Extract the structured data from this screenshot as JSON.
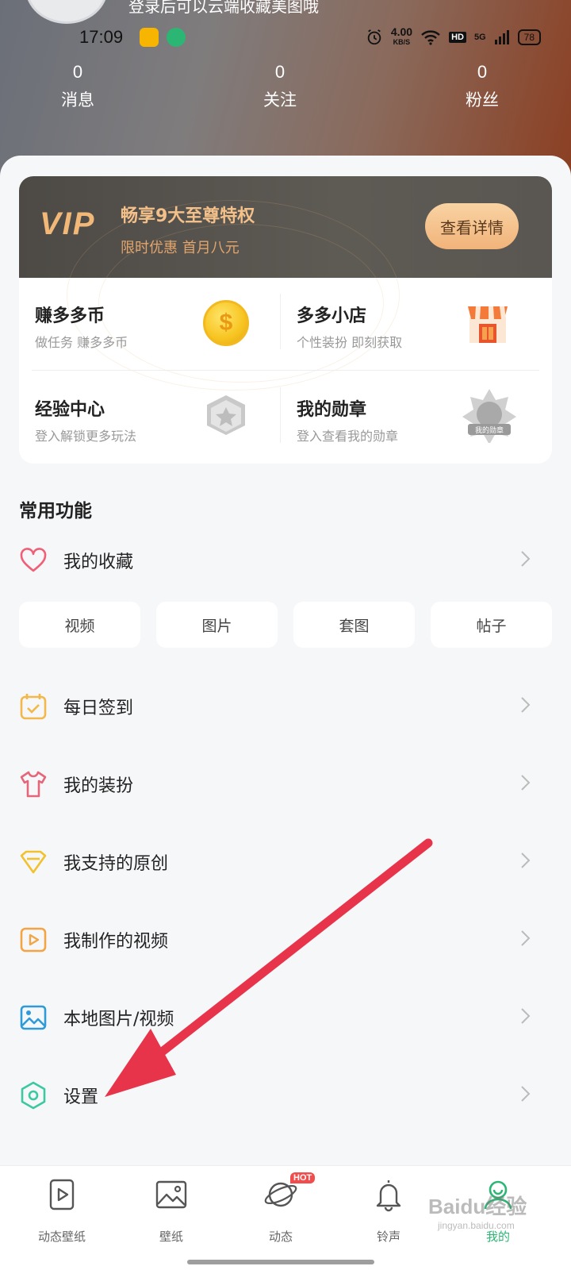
{
  "status_bar": {
    "time": "17:09",
    "net_speed": "4.00",
    "net_unit": "KB/S",
    "hd": "HD",
    "signal": "5G",
    "battery": "78"
  },
  "profile": {
    "login_hint": "登录后可以云端收藏美图哦",
    "stats": [
      {
        "value": "0",
        "label": "消息"
      },
      {
        "value": "0",
        "label": "关注"
      },
      {
        "value": "0",
        "label": "粉丝"
      }
    ]
  },
  "vip": {
    "logo": "VIP",
    "title": "畅享9大至尊特权",
    "subtitle": "限时优惠 首月八元",
    "button": "查看详情"
  },
  "grid": [
    {
      "title": "赚多多币",
      "subtitle": "做任务 赚多多币",
      "icon": "coin-icon"
    },
    {
      "title": "多多小店",
      "subtitle": "个性装扮 即刻获取",
      "icon": "shop-icon"
    },
    {
      "title": "经验中心",
      "subtitle": "登入解锁更多玩法",
      "icon": "level-badge-icon"
    },
    {
      "title": "我的勋章",
      "subtitle": "登入查看我的勋章",
      "icon": "medal-icon",
      "badge_text": "我的勋章"
    }
  ],
  "section": {
    "title": "常用功能"
  },
  "favorites": {
    "label": "我的收藏",
    "tiles": [
      "视频",
      "图片",
      "套图",
      "帖子"
    ]
  },
  "menu": [
    {
      "label": "每日签到",
      "icon": "calendar-check-icon"
    },
    {
      "label": "我的装扮",
      "icon": "shirt-icon"
    },
    {
      "label": "我支持的原创",
      "icon": "diamond-icon"
    },
    {
      "label": "我制作的视频",
      "icon": "play-icon"
    },
    {
      "label": "本地图片/视频",
      "icon": "image-icon"
    },
    {
      "label": "设置",
      "icon": "settings-icon"
    }
  ],
  "bottom_nav": [
    {
      "label": "动态壁纸",
      "icon": "live-wallpaper-icon"
    },
    {
      "label": "壁纸",
      "icon": "wallpaper-icon"
    },
    {
      "label": "动态",
      "icon": "planet-icon",
      "badge": "HOT"
    },
    {
      "label": "铃声",
      "icon": "bell-icon"
    },
    {
      "label": "我的",
      "icon": "profile-icon",
      "active": true
    }
  ],
  "watermark": {
    "text": "Baidu经验",
    "sub": "jingyan.baidu.com"
  },
  "colors": {
    "accent": "#2bb673",
    "vip_gold": "#f1b878",
    "arrow": "#e8344a"
  }
}
